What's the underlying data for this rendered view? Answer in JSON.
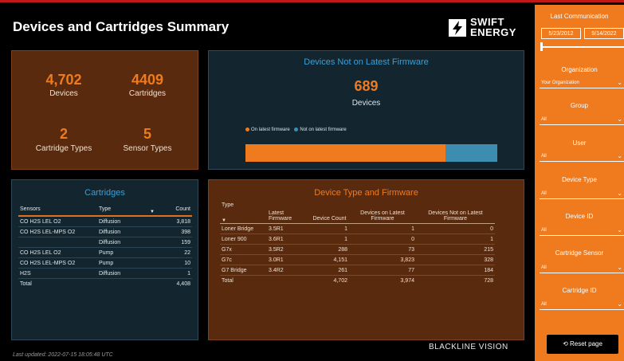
{
  "header": {
    "title": "Devices and Cartridges Summary",
    "logo_line1": "SWIFT",
    "logo_line2": "ENERGY"
  },
  "kpis": {
    "devices_value": "4,702",
    "devices_label": "Devices",
    "cartridges_value": "4409",
    "cartridges_label": "Cartridges",
    "cartridge_types_value": "2",
    "cartridge_types_label": "Cartridge Types",
    "sensor_types_value": "5",
    "sensor_types_label": "Sensor Types"
  },
  "firmware": {
    "title": "Devices Not on Latest Firmware",
    "value": "689",
    "label": "Devices",
    "legend_on": "On latest firmware",
    "legend_not": "Not on latest firmware",
    "on_latest_fraction": 0.795,
    "color_on": "#f07a1e",
    "color_not": "#3d8db0"
  },
  "cartridges": {
    "title": "Cartridges",
    "headers": [
      "Sensors",
      "Type",
      "Count"
    ],
    "rows": [
      [
        "CO H2S LEL O2",
        "Diffusion",
        "3,818"
      ],
      [
        "CO H2S LEL-MPS O2",
        "Diffusion",
        "398"
      ],
      [
        "",
        "Diffusion",
        "159"
      ],
      [
        "CO H2S LEL O2",
        "Pump",
        "22"
      ],
      [
        "CO H2S LEL-MPS O2",
        "Pump",
        "10"
      ],
      [
        "H2S",
        "Diffusion",
        "1"
      ]
    ],
    "total": [
      "Total",
      "",
      "4,408"
    ]
  },
  "device_types": {
    "title": "Device Type and Firmware",
    "headers": [
      "Type",
      "Latest Firmware",
      "Device Count",
      "Devices on Latest Firmware",
      "Devices Not on Latest Firmware"
    ],
    "rows": [
      [
        "Loner Bridge",
        "3.5R1",
        "1",
        "1",
        "0"
      ],
      [
        "Loner 900",
        "3.6R1",
        "1",
        "0",
        "1"
      ],
      [
        "G7x",
        "3.5R2",
        "288",
        "73",
        "215"
      ],
      [
        "G7c",
        "3.0R1",
        "4,151",
        "3,823",
        "328"
      ],
      [
        "G7 Bridge",
        "3.4R2",
        "261",
        "77",
        "184"
      ]
    ],
    "total": [
      "Total",
      "",
      "4,702",
      "3,974",
      "728"
    ]
  },
  "footer": {
    "brand": "BLACKLINE VISION",
    "updated": "Last updated: 2022-07-15 18:05:48 UTC"
  },
  "filters": {
    "last_comm_label": "Last Communication",
    "date_from": "5/23/2012",
    "date_to": "9/14/2022",
    "organization_label": "Organization",
    "organization_value": "Your Organization",
    "group_label": "Group",
    "group_value": "All",
    "user_label": "User",
    "user_value": "All",
    "device_type_label": "Device Type",
    "device_type_value": "All",
    "device_id_label": "Device ID",
    "device_id_value": "All",
    "cartridge_sensor_label": "Cartridge Sensor",
    "cartridge_sensor_value": "All",
    "cartridge_id_label": "Cartridge ID",
    "cartridge_id_value": "All",
    "reset_label": "Reset page"
  }
}
